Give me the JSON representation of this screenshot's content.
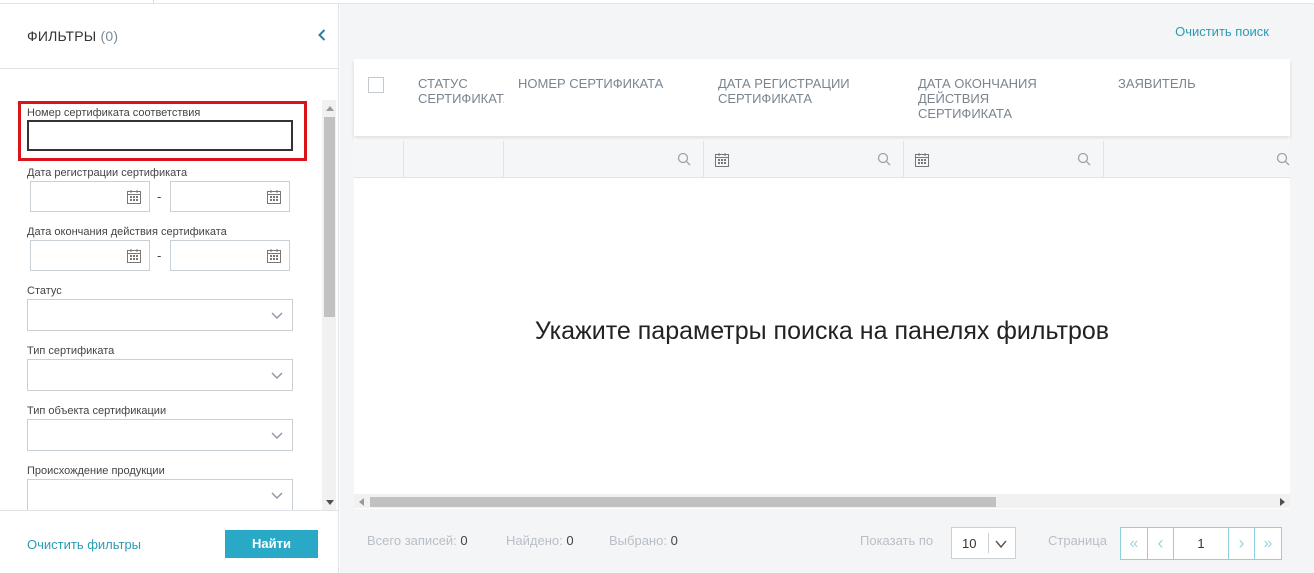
{
  "filters_panel": {
    "title": "ФИЛЬТРЫ",
    "count": "(0)",
    "fields": {
      "cert_number_label": "Номер сертификата соответствия",
      "cert_number_value": "",
      "reg_date_label": "Дата регистрации сертификата",
      "end_date_label": "Дата окончания действия сертификата",
      "date_separator": "-",
      "status_label": "Статус",
      "cert_type_label": "Тип сертификата",
      "object_type_label": "Тип объекта сертификации",
      "origin_label": "Происхождение продукции"
    },
    "clear_filters": "Очистить фильтры",
    "find_button": "Найти"
  },
  "main": {
    "clear_search": "Очистить поиск",
    "columns": [
      "СТАТУС СЕРТИФИКАТА",
      "НОМЕР СЕРТИФИКАТА",
      "ДАТА РЕГИСТРАЦИИ СЕРТИФИКАТА",
      "ДАТА ОКОНЧАНИЯ ДЕЙСТВИЯ СЕРТИФИКАТА",
      "ЗАЯВИТЕЛЬ"
    ],
    "empty_message": "Укажите параметры поиска на панелях фильтров"
  },
  "footer": {
    "total_label": "Всего записей:",
    "total_value": "0",
    "found_label": "Найдено:",
    "found_value": "0",
    "selected_label": "Выбрано:",
    "selected_value": "0",
    "show_by_label": "Показать по",
    "page_size": "10",
    "page_label": "Страница",
    "current_page": "1",
    "first_glyph": "«",
    "prev_glyph": "‹",
    "next_glyph": "›",
    "last_glyph": "»"
  },
  "colors": {
    "accent": "#29a9c6",
    "link": "#2a9cb3",
    "highlight": "#d9141b"
  }
}
